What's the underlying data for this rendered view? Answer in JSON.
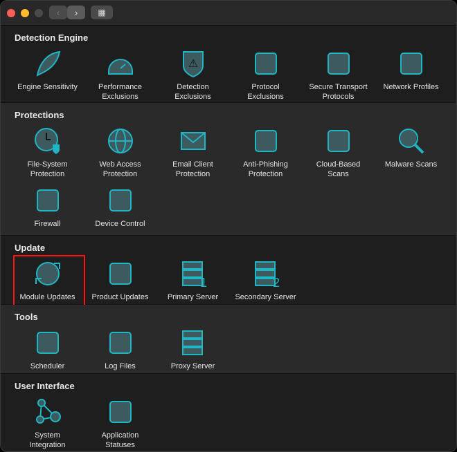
{
  "sections": [
    {
      "title": "Detection Engine",
      "items": [
        {
          "label": "Engine Sensitivity",
          "icon": "feather-icon"
        },
        {
          "label": "Performance\nExclusions",
          "icon": "speedometer-icon"
        },
        {
          "label": "Detection\nExclusions",
          "icon": "shield-warning-icon"
        },
        {
          "label": "Protocol\nExclusions",
          "icon": "folder-signal-icon"
        },
        {
          "label": "Secure Transport\nProtocols",
          "icon": "shield-gear-icon"
        },
        {
          "label": "Network Profiles",
          "icon": "wifi-list-icon"
        }
      ]
    },
    {
      "title": "Protections",
      "items": [
        {
          "label": "File-System\nProtection",
          "icon": "clock-shield-icon"
        },
        {
          "label": "Web Access\nProtection",
          "icon": "globe-icon"
        },
        {
          "label": "Email Client\nProtection",
          "icon": "envelope-icon"
        },
        {
          "label": "Anti-Phishing\nProtection",
          "icon": "hook-icon"
        },
        {
          "label": "Cloud-Based\nScans",
          "icon": "cloud-shield-icon"
        },
        {
          "label": "Malware Scans",
          "icon": "magnifier-icon"
        },
        {
          "label": "Firewall",
          "icon": "firewall-icon"
        },
        {
          "label": "Device Control",
          "icon": "usb-lock-icon"
        }
      ]
    },
    {
      "title": "Update",
      "items": [
        {
          "label": "Module Updates",
          "icon": "refresh-icon",
          "selected": true
        },
        {
          "label": "Product Updates",
          "icon": "list-refresh-icon"
        },
        {
          "label": "Primary Server",
          "icon": "server-1-icon"
        },
        {
          "label": "Secondary Server",
          "icon": "server-2-icon"
        }
      ]
    },
    {
      "title": "Tools",
      "items": [
        {
          "label": "Scheduler",
          "icon": "calendar-icon"
        },
        {
          "label": "Log Files",
          "icon": "documents-icon"
        },
        {
          "label": "Proxy Server",
          "icon": "server-icon"
        }
      ]
    },
    {
      "title": "User Interface",
      "items": [
        {
          "label": "System\nIntegration",
          "icon": "nodes-icon"
        },
        {
          "label": "Application\nStatuses",
          "icon": "status-list-icon"
        }
      ]
    }
  ],
  "colors": {
    "accent": "#20b5c4",
    "fill": "#3d5a5e",
    "selection": "#ff1414"
  }
}
